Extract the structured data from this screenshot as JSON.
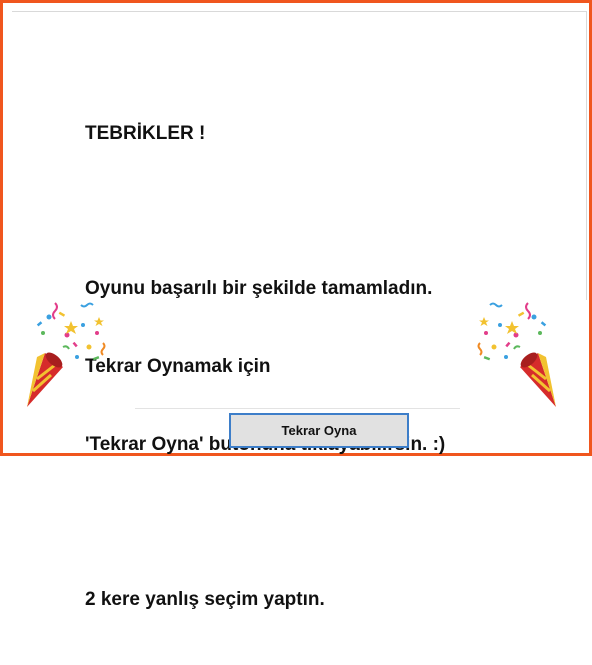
{
  "dialog": {
    "title_line": "TEBRİKLER !",
    "message_lines": [
      "Oyunu başarılı bir şekilde tamamladın.",
      "Tekrar Oynamak için",
      "'Tekrar Oyna' butonuna tıklayabilirsin. :)"
    ],
    "mistake_line": "2 kere yanlış seçim yaptın."
  },
  "button": {
    "label": "Tekrar Oyna"
  },
  "decorations": {
    "left_icon": "party-popper-icon",
    "right_icon": "party-popper-icon"
  },
  "colors": {
    "frame_border": "#f0561e",
    "button_border": "#3d7ec9",
    "button_bg": "#e1e1e1"
  }
}
